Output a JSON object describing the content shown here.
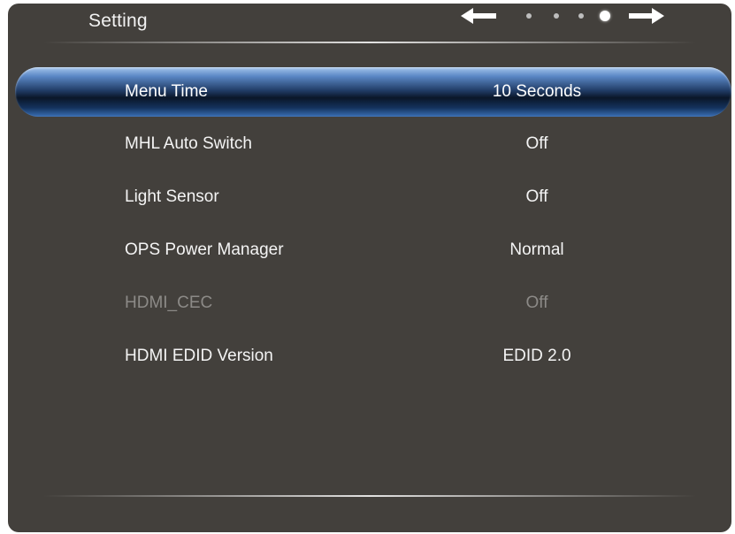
{
  "header": {
    "title": "Setting"
  },
  "pager": {
    "page_count": 4,
    "active_page": 4
  },
  "menu": {
    "items": [
      {
        "label": "Menu Time",
        "value": "10 Seconds",
        "selected": true,
        "enabled": true
      },
      {
        "label": "MHL Auto Switch",
        "value": "Off",
        "selected": false,
        "enabled": true
      },
      {
        "label": "Light Sensor",
        "value": "Off",
        "selected": false,
        "enabled": true
      },
      {
        "label": "OPS Power Manager",
        "value": "Normal",
        "selected": false,
        "enabled": true
      },
      {
        "label": "HDMI_CEC",
        "value": "Off",
        "selected": false,
        "enabled": false
      },
      {
        "label": "HDMI EDID Version",
        "value": "EDID 2.0",
        "selected": false,
        "enabled": true
      }
    ]
  },
  "colors": {
    "panel": "#43403c",
    "highlight": "#1f3a63",
    "disabled_text": "#8c8a87"
  }
}
